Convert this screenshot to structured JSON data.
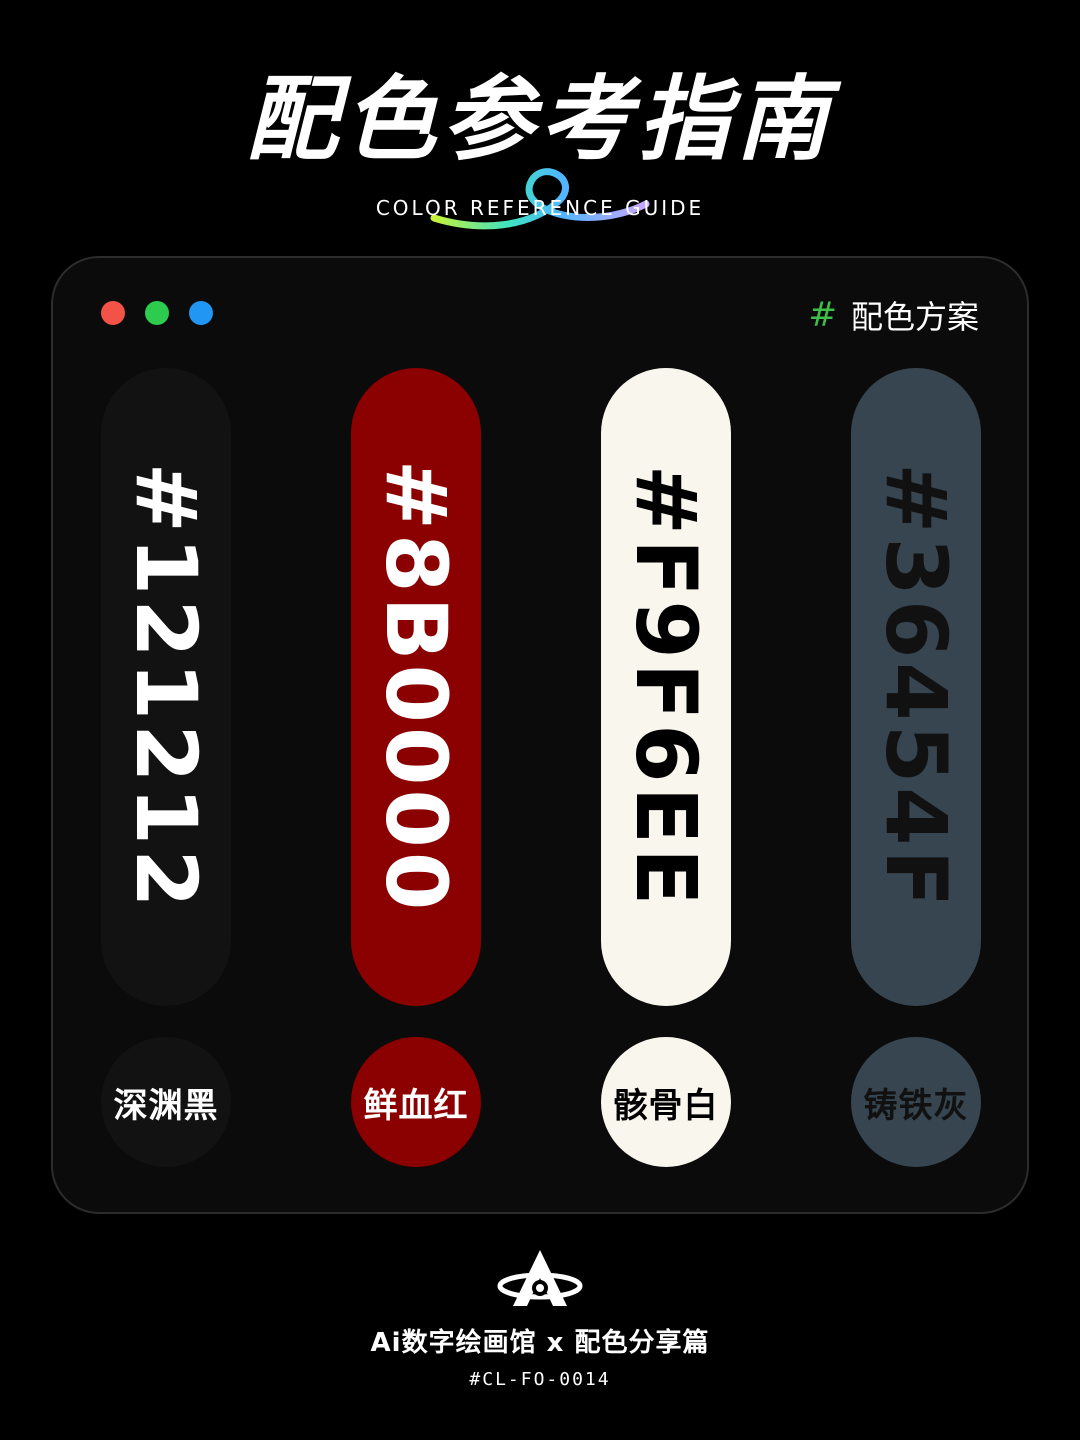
{
  "header": {
    "title": "配色参考指南",
    "subtitle": "COLOR REFERENCE GUIDE"
  },
  "window": {
    "dot_colors": [
      "#f25346",
      "#2ecc4e",
      "#2196f3"
    ],
    "scheme_hash": "#",
    "scheme_label": "配色方案"
  },
  "swatches": [
    {
      "hex": "#121212",
      "name": "深渊黑",
      "bg": "#121212",
      "text_color": "#ffffff"
    },
    {
      "hex": "#8B0000",
      "name": "鲜血红",
      "bg": "#8B0000",
      "text_color": "#ffffff"
    },
    {
      "hex": "#F9F6EE",
      "name": "骸骨白",
      "bg": "#F9F6EE",
      "text_color": "#000000"
    },
    {
      "hex": "#36454F",
      "name": "铸铁灰",
      "bg": "#36454F",
      "text_color": "#111111"
    }
  ],
  "footer": {
    "brand": "Ai数字绘画馆 x 配色分享篇",
    "code": "#CL-FO-0014"
  }
}
